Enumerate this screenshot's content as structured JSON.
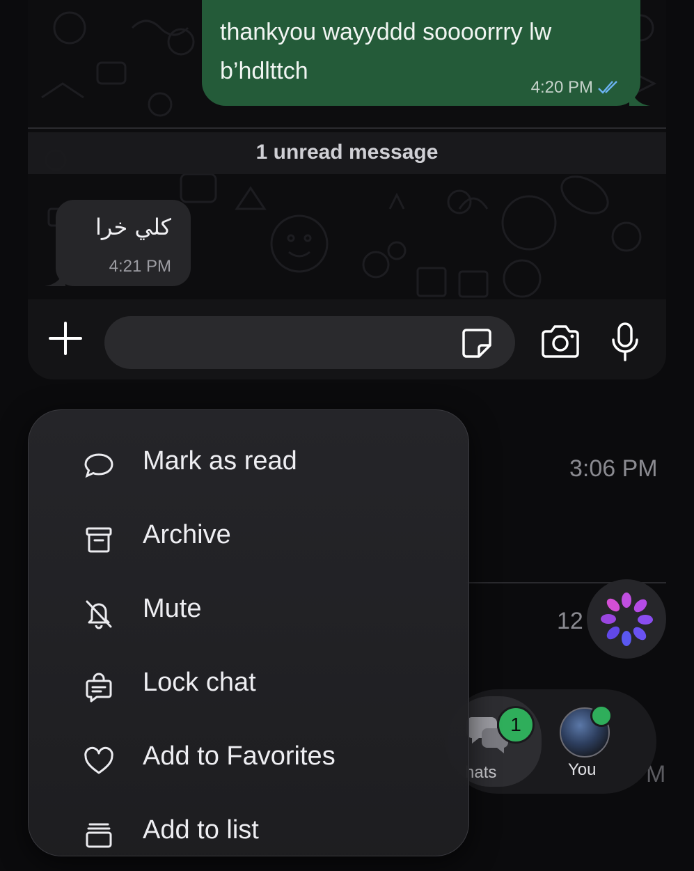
{
  "chat": {
    "outgoing": {
      "text": "thankyou wayyddd soooorrry lw b’hdlttch",
      "time": "4:20 PM",
      "status_icon": "double-check-read-icon"
    },
    "unread_banner": "1 unread message",
    "incoming": {
      "text": "كلي خرا",
      "time": "4:21 PM"
    }
  },
  "input_bar": {
    "placeholder": "",
    "icons": [
      "plus-icon",
      "sticker-icon",
      "camera-icon",
      "microphone-icon"
    ]
  },
  "background": {
    "chat_list_times": [
      "3:06 PM",
      "12",
      "M"
    ],
    "tabs": {
      "chats_label": "hats",
      "chats_badge": "1",
      "you_label": "You"
    }
  },
  "menu": {
    "items": [
      {
        "label": "Mark as read",
        "icon": "chat-bubble-icon"
      },
      {
        "label": "Archive",
        "icon": "archive-box-icon"
      },
      {
        "label": "Mute",
        "icon": "bell-off-icon"
      },
      {
        "label": "Lock chat",
        "icon": "lock-chat-icon"
      },
      {
        "label": "Add to Favorites",
        "icon": "heart-icon"
      },
      {
        "label": "Add to list",
        "icon": "add-list-icon"
      }
    ]
  },
  "colors": {
    "outgoing_bubble": "#245b39",
    "incoming_bubble": "#262629",
    "badge": "#2fae5b",
    "read_ticks": "#6cb3f3"
  }
}
